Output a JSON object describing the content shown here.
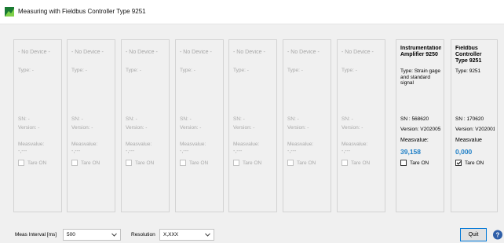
{
  "window": {
    "title": "Measuring with Fieldbus Controller Type 9251"
  },
  "colors": {
    "accent_value": "#1f7fc6",
    "logo_green": "#1a7a33",
    "disabled_text": "#a8a8a8"
  },
  "channels": [
    {
      "name": "- No Device -",
      "type": "Type: -",
      "sn": "SN: -",
      "version": "Version: -",
      "meas_label": "Measvalue:",
      "meas_value": "-,---",
      "tare_label": "Tare ON",
      "tare_checked": false,
      "enabled": false
    },
    {
      "name": "- No Device -",
      "type": "Type: -",
      "sn": "SN: -",
      "version": "Version: -",
      "meas_label": "Measvalue:",
      "meas_value": "-,---",
      "tare_label": "Tare ON",
      "tare_checked": false,
      "enabled": false
    },
    {
      "name": "- No Device -",
      "type": "Type: -",
      "sn": "SN: -",
      "version": "Version: -",
      "meas_label": "Measvalue:",
      "meas_value": "-,---",
      "tare_label": "Tare ON",
      "tare_checked": false,
      "enabled": false
    },
    {
      "name": "- No Device -",
      "type": "Type: -",
      "sn": "SN: -",
      "version": "Version: -",
      "meas_label": "Measvalue:",
      "meas_value": "-,---",
      "tare_label": "Tare ON",
      "tare_checked": false,
      "enabled": false
    },
    {
      "name": "- No Device -",
      "type": "Type: -",
      "sn": "SN: -",
      "version": "Version: -",
      "meas_label": "Measvalue:",
      "meas_value": "-,---",
      "tare_label": "Tare ON",
      "tare_checked": false,
      "enabled": false
    },
    {
      "name": "- No Device -",
      "type": "Type: -",
      "sn": "SN: -",
      "version": "Version: -",
      "meas_label": "Measvalue:",
      "meas_value": "-,---",
      "tare_label": "Tare ON",
      "tare_checked": false,
      "enabled": false
    },
    {
      "name": "- No Device -",
      "type": "Type: -",
      "sn": "SN: -",
      "version": "Version: -",
      "meas_label": "Measvalue:",
      "meas_value": "-,---",
      "tare_label": "Tare ON",
      "tare_checked": false,
      "enabled": false
    },
    {
      "name": "Instrumentation Amplifier 9250",
      "type": "Type: Strain gage and standard signal",
      "sn": "SN : 568620",
      "version": "Version: V202005",
      "meas_label": "Measvalue:",
      "meas_value": "39,158",
      "tare_label": "Tare ON",
      "tare_checked": false,
      "enabled": true
    },
    {
      "name": "Fieldbus Controller Type 9251",
      "type": "Type: 9251",
      "sn": "SN : 170620",
      "version": "Version: V202001",
      "meas_label": "Measvalue",
      "meas_value": "0,000",
      "tare_label": "Tare ON",
      "tare_checked": true,
      "enabled": true
    }
  ],
  "controls": {
    "meas_interval_label": "Meas Interval [ms]",
    "meas_interval_value": "500",
    "resolution_label": "Resolution",
    "resolution_value": "X,XXX",
    "quit_label": "Quit",
    "help_icon": "help-icon"
  }
}
